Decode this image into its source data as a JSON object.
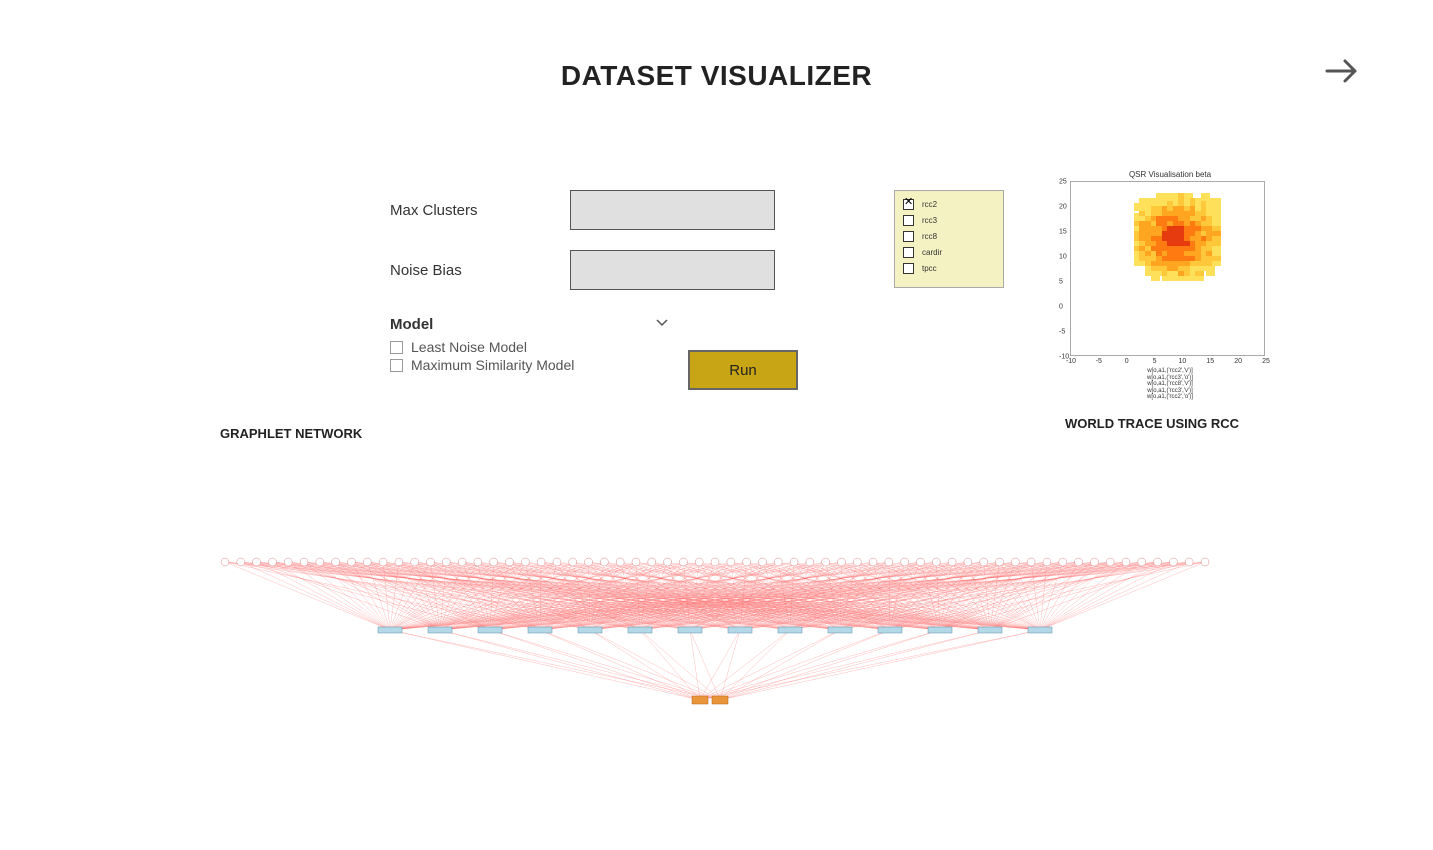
{
  "header": {
    "title": "DATASET VISUALIZER"
  },
  "controls": {
    "max_clusters_label": "Max Clusters",
    "max_clusters_value": "",
    "noise_bias_label": "Noise Bias",
    "noise_bias_value": "",
    "model_label": "Model",
    "options": [
      {
        "label": "Least Noise Model",
        "checked": false
      },
      {
        "label": "Maximum Similarity Model",
        "checked": false
      }
    ],
    "run_label": "Run"
  },
  "legend": {
    "items": [
      {
        "label": "rcc2",
        "checked": true
      },
      {
        "label": "rcc3",
        "checked": false
      },
      {
        "label": "rcc8",
        "checked": false
      },
      {
        "label": "cardir",
        "checked": false
      },
      {
        "label": "tpcc",
        "checked": false
      }
    ]
  },
  "chart_data": {
    "type": "heatmap",
    "title": "QSR Visualisation beta",
    "xlabel": "",
    "ylabel": "",
    "xlim": [
      -10,
      25
    ],
    "ylim": [
      -10,
      25
    ],
    "xticks": [
      -10,
      -5,
      0,
      5,
      10,
      15,
      20,
      25
    ],
    "yticks": [
      -10,
      -5,
      0,
      5,
      10,
      15,
      20,
      25
    ],
    "legend_lines": [
      "w[o,a1,('rcc2','v')]",
      "w[o,a1,('rcc3','o')]",
      "w[o,a1,('rcc8','v')]",
      "w[o,a1,('rcc3','v')]",
      "w[o,a1,('rcc2','o')]"
    ],
    "heat_region": {
      "x_range": [
        2,
        16
      ],
      "y_range": [
        6,
        22
      ],
      "note": "dense yellow-orange-red blob roughly centered around x≈8 y≈14"
    }
  },
  "sections": {
    "graphlet_label": "GRAPHLET NETWORK",
    "worldtrace_label": "WORLD TRACE USING RCC"
  },
  "network": {
    "top_node_count": 63,
    "mid_node_count": 14,
    "bottom_node_count": 2
  }
}
